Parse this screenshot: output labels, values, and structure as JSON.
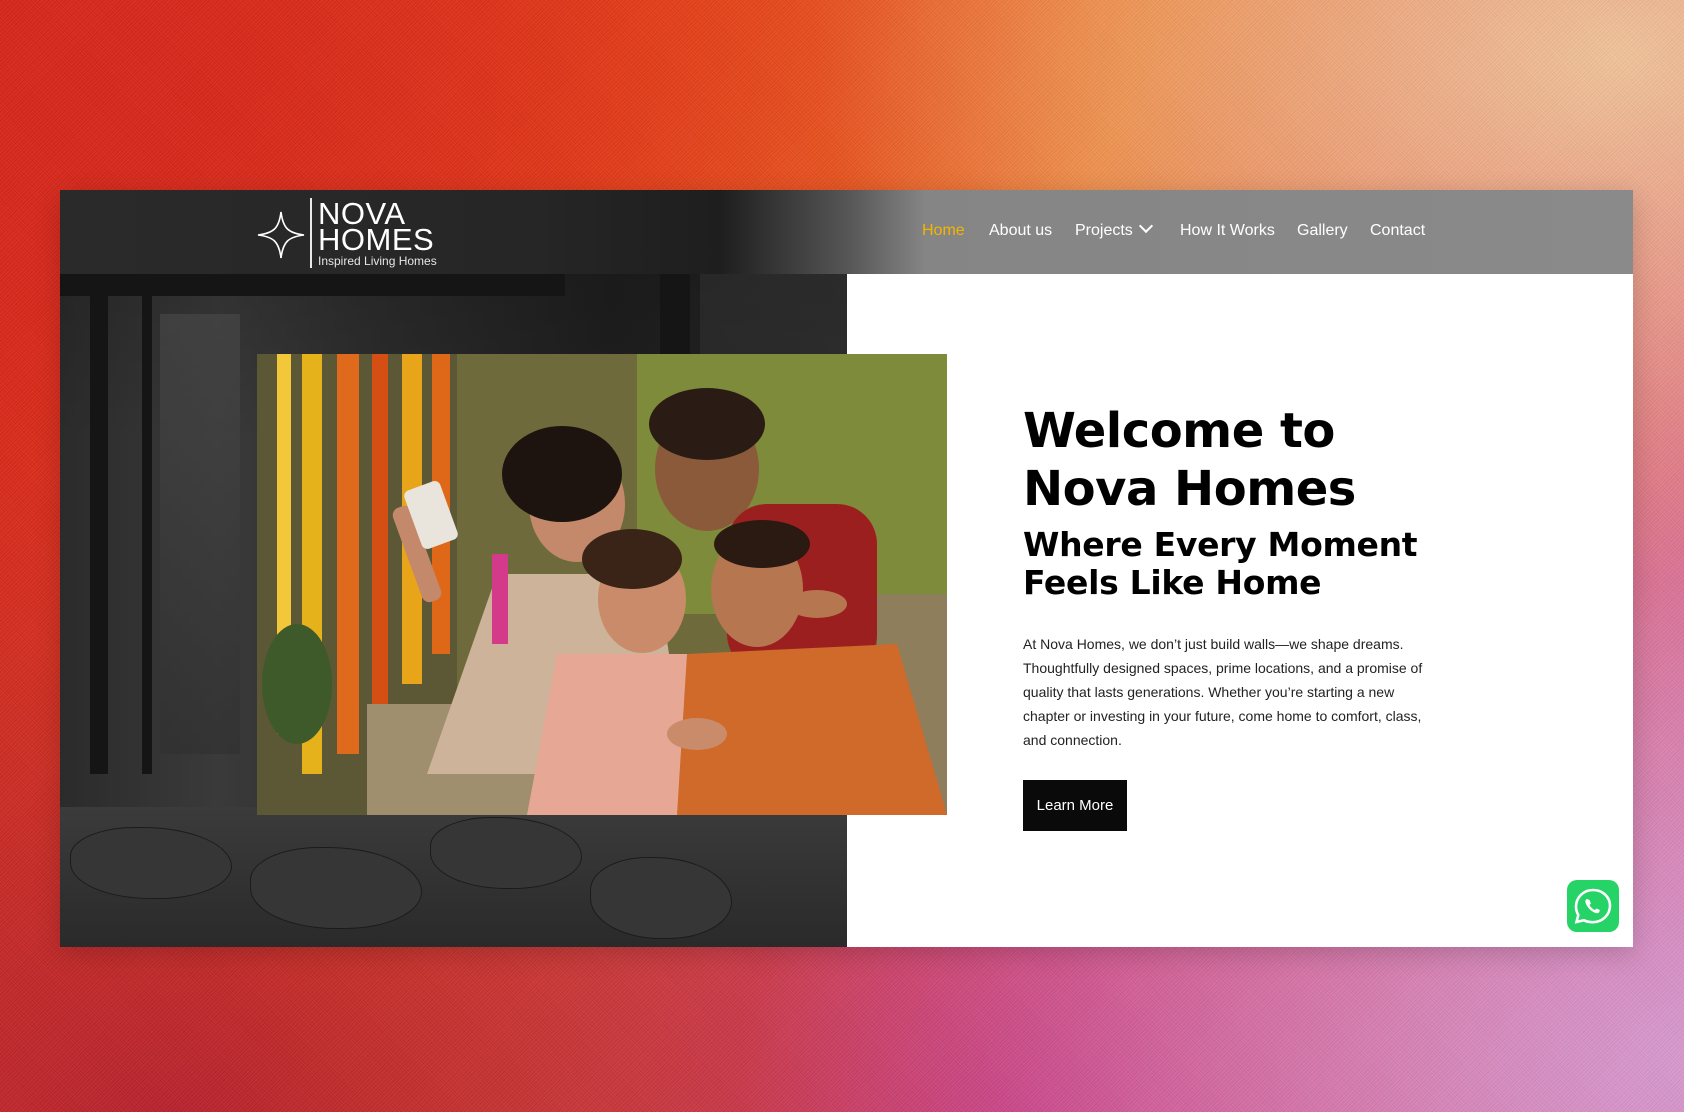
{
  "brand": {
    "line1": "NOVA",
    "line2": "HOMES",
    "tagline": "Inspired Living Homes"
  },
  "nav": {
    "items": [
      {
        "label": "Home",
        "active": true
      },
      {
        "label": "About us",
        "active": false
      },
      {
        "label": "Projects",
        "active": false,
        "has_dropdown": true
      },
      {
        "label": "How It Works",
        "active": false
      },
      {
        "label": "Gallery",
        "active": false
      },
      {
        "label": "Contact",
        "active": false
      }
    ]
  },
  "hero": {
    "title_line1": "Welcome to",
    "title_line2": "Nova Homes",
    "subtitle_line1": "Where Every Moment",
    "subtitle_line2": "Feels Like Home",
    "body": "At Nova Homes, we don’t just build walls—we shape dreams. Thoughtfully designed spaces, prime locations, and a promise of quality that lasts generations. Whether you’re starting a new chapter or investing in your future, come home to comfort, class, and connection.",
    "button_label": "Learn More"
  },
  "colors": {
    "active_nav": "#f5b400",
    "button_bg": "#0a0a0a",
    "whatsapp": "#25d366"
  },
  "icons": {
    "logo": "four-point-star-icon",
    "dropdown": "chevron-down-icon",
    "chat": "whatsapp-icon"
  }
}
